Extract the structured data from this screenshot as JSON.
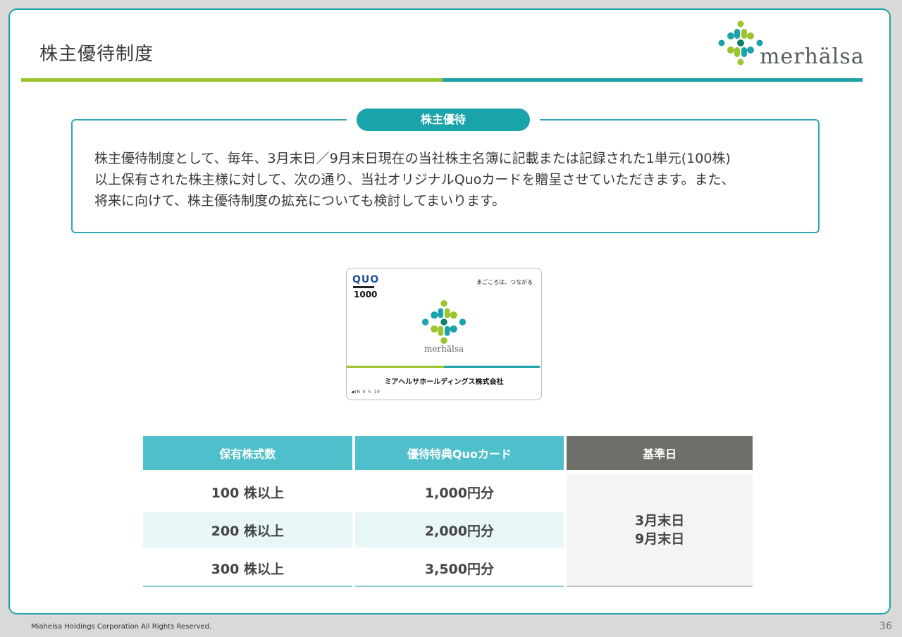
{
  "header": {
    "title": "株主優待制度",
    "logo_text": "merhälsa"
  },
  "colors": {
    "teal": "#1aa3aa",
    "green": "#9bc42f",
    "light_teal": "#4fc0cb",
    "gray_header": "#6f6f69"
  },
  "benefit_box": {
    "badge": "株主優待",
    "lines": [
      "株主優待制度として、毎年、3月末日／9月末日現在の当社株主名簿に記載または記録された1単元(100株)",
      "以上保有された株主様に対して、次の通り、当社オリジナルQuoカードを贈呈させていただきます。また、",
      "将来に向けて、株主優待制度の拡充についても検討してまいります。"
    ]
  },
  "card": {
    "brand_mark": "QUO",
    "value": "1000",
    "tagline": "まごころは、つながる",
    "brand": "merhälsa",
    "company": "ミアヘルサホールディングス株式会社",
    "scale": "◀IN  0  5  10"
  },
  "table": {
    "headers": [
      "保有株式数",
      "優待特典Quoカード",
      "基準日"
    ],
    "rows": [
      {
        "shares": "100 株以上",
        "card": "1,000円分"
      },
      {
        "shares": "200 株以上",
        "card": "2,000円分"
      },
      {
        "shares": "300 株以上",
        "card": "3,500円分"
      }
    ],
    "record_dates": [
      "3月末日",
      "9月末日"
    ]
  },
  "footer": {
    "copyright": "Miahelsa Holdings Corporation All Rights Reserved.",
    "page_number": "36"
  }
}
